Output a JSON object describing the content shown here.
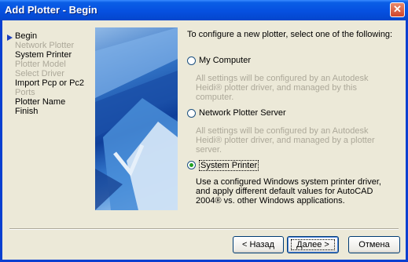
{
  "window": {
    "title": "Add Plotter - Begin",
    "close_glyph": "✕"
  },
  "steps": [
    {
      "label": "Begin",
      "enabled": true,
      "current": true
    },
    {
      "label": "Network Plotter",
      "enabled": false
    },
    {
      "label": "System Printer",
      "enabled": true
    },
    {
      "label": "Plotter Model",
      "enabled": false
    },
    {
      "label": "Select Driver",
      "enabled": false
    },
    {
      "label": "Import Pcp or Pc2",
      "enabled": true
    },
    {
      "label": "Ports",
      "enabled": false
    },
    {
      "label": "Plotter Name",
      "enabled": true
    },
    {
      "label": "Finish",
      "enabled": true
    }
  ],
  "intro": "To configure a new plotter, select one of the following:",
  "options": {
    "my_computer": {
      "label": "My Computer",
      "selected": false,
      "description": "All settings will be configured by an Autodesk Heidi® plotter driver, and managed by this computer."
    },
    "network_server": {
      "label": "Network Plotter Server",
      "selected": false,
      "description": "All settings will be configured by an Autodesk Heidi® plotter driver, and managed by a plotter server."
    },
    "system_printer": {
      "label": "System Printer",
      "selected": true,
      "description": "Use a configured Windows system printer driver, and apply different default values for AutoCAD 2004® vs. other Windows applications."
    }
  },
  "buttons": {
    "back": "< Назад",
    "next": "Далее >",
    "cancel": "Отмена"
  },
  "colors": {
    "title_bar": "#0a5ee6",
    "selected_radio": "#21a121",
    "disabled_text": "#aca899"
  }
}
